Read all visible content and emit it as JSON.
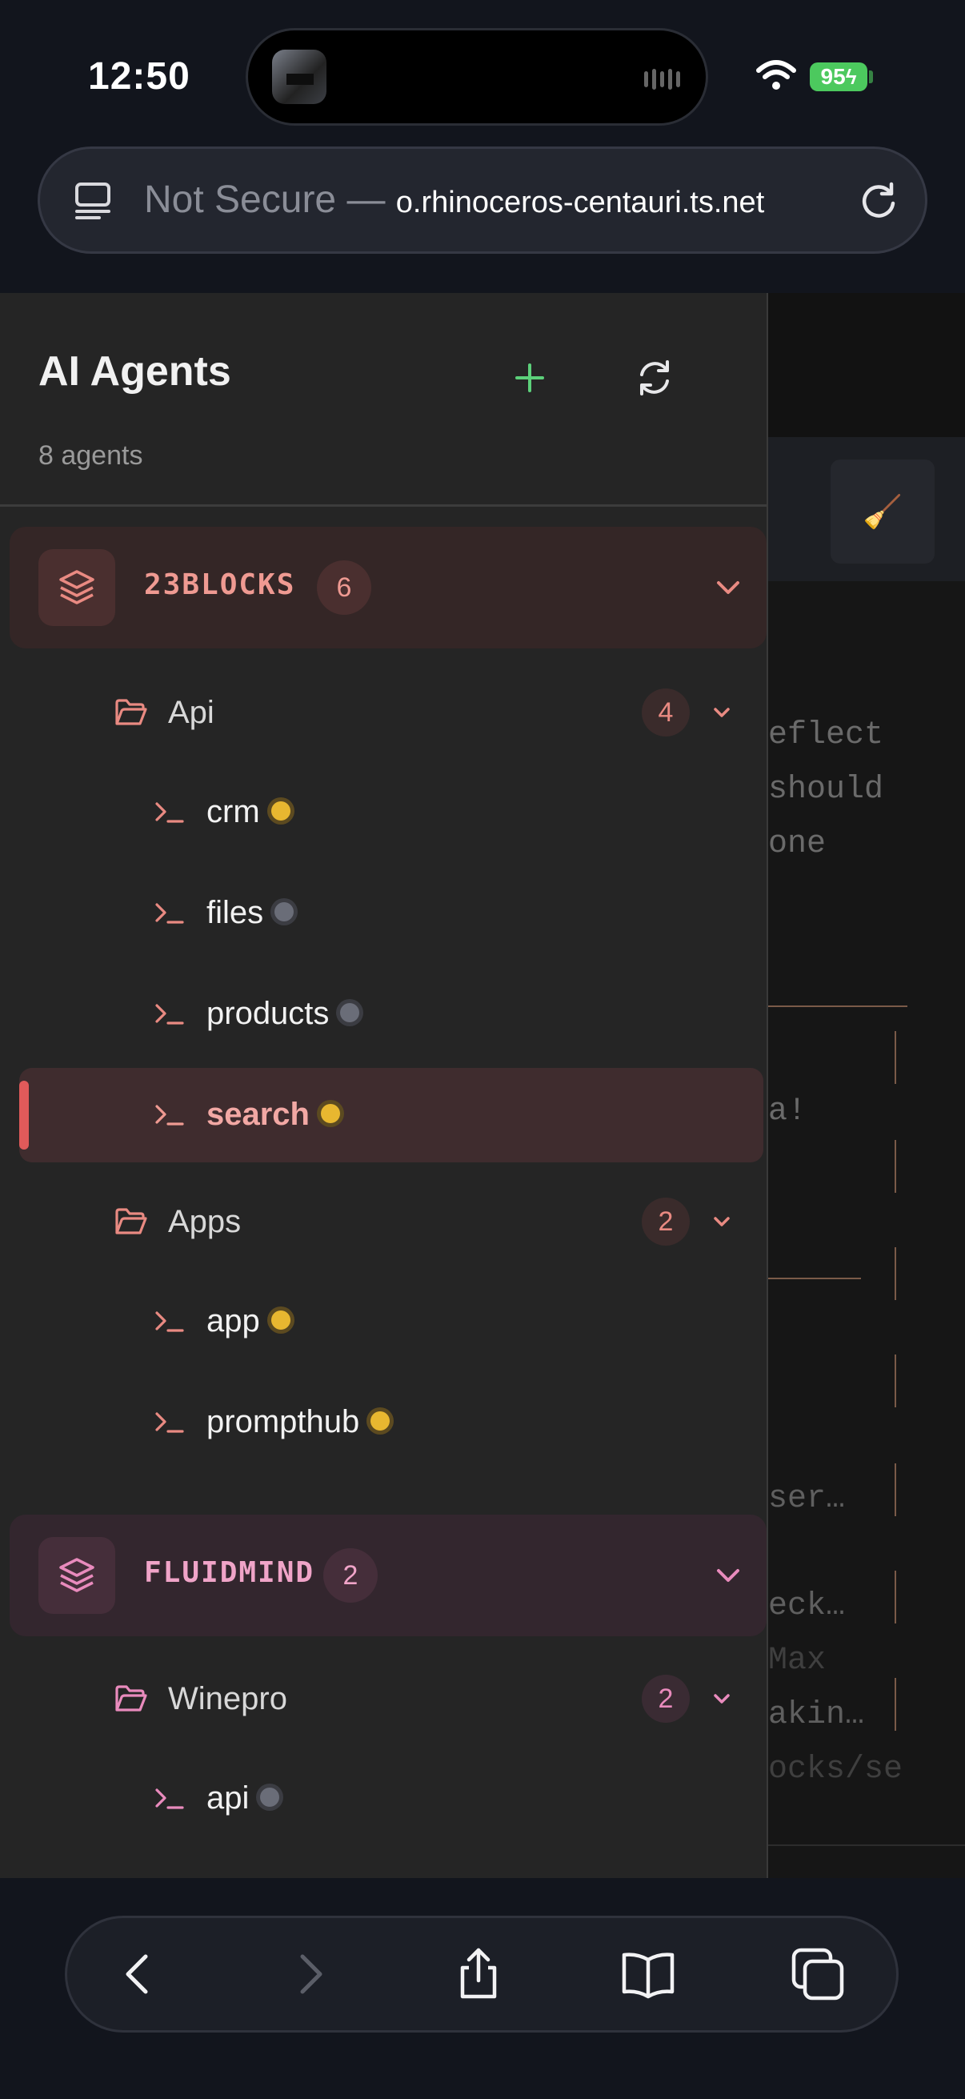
{
  "status_bar": {
    "time": "12:50",
    "battery": "95"
  },
  "browser": {
    "url_prefix": "Not Secure — ",
    "url_host": "o.rhinoceros-centauri.ts.net"
  },
  "background_page": {
    "lines": [
      "eflect",
      "should",
      "one",
      "a!",
      "ser…",
      "eck…",
      "Max",
      "akin…",
      "ocks/se"
    ]
  },
  "sidebar": {
    "title": "AI Agents",
    "agent_count": "8 agents",
    "groups": [
      {
        "name": "23BLOCKS",
        "count": "6",
        "folders": [
          {
            "name": "Api",
            "count": "4",
            "agents": [
              {
                "name": "crm",
                "status": "active"
              },
              {
                "name": "files",
                "status": "idle"
              },
              {
                "name": "products",
                "status": "idle"
              },
              {
                "name": "search",
                "status": "active",
                "selected": true
              }
            ]
          },
          {
            "name": "Apps",
            "count": "2",
            "agents": [
              {
                "name": "app",
                "status": "active"
              },
              {
                "name": "prompthub",
                "status": "active"
              }
            ]
          }
        ]
      },
      {
        "name": "FLUIDMIND",
        "count": "2",
        "folders": [
          {
            "name": "Winepro",
            "count": "2",
            "agents": [
              {
                "name": "api",
                "status": "idle"
              }
            ]
          }
        ]
      }
    ]
  },
  "colors": {
    "group_23blocks": "#e98a82",
    "group_fluidmind": "#e98bbd",
    "status_active": "#e8b730",
    "status_idle": "#6a6d78",
    "add_accent": "#5cd07a",
    "selected_accent": "#e05a5a"
  },
  "icons": {
    "group": "layers-icon",
    "folder": "folder-open-icon",
    "agent": "terminal-icon",
    "nav": [
      "back-icon",
      "forward-icon",
      "share-icon",
      "bookmarks-icon",
      "tabs-icon"
    ]
  }
}
